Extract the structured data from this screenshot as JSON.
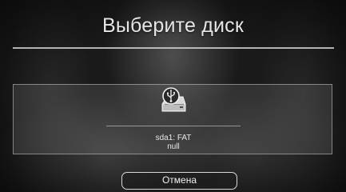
{
  "dialog": {
    "title": "Выберите диск",
    "disks": [
      {
        "icon": "usb-drive-icon",
        "name": "sda1: FAT",
        "sub": "null"
      }
    ],
    "cancel_label": "Отмена"
  },
  "colors": {
    "text": "#e6e6e6",
    "divider": "#cfcfcf",
    "button_border": "#d8d8d8"
  }
}
